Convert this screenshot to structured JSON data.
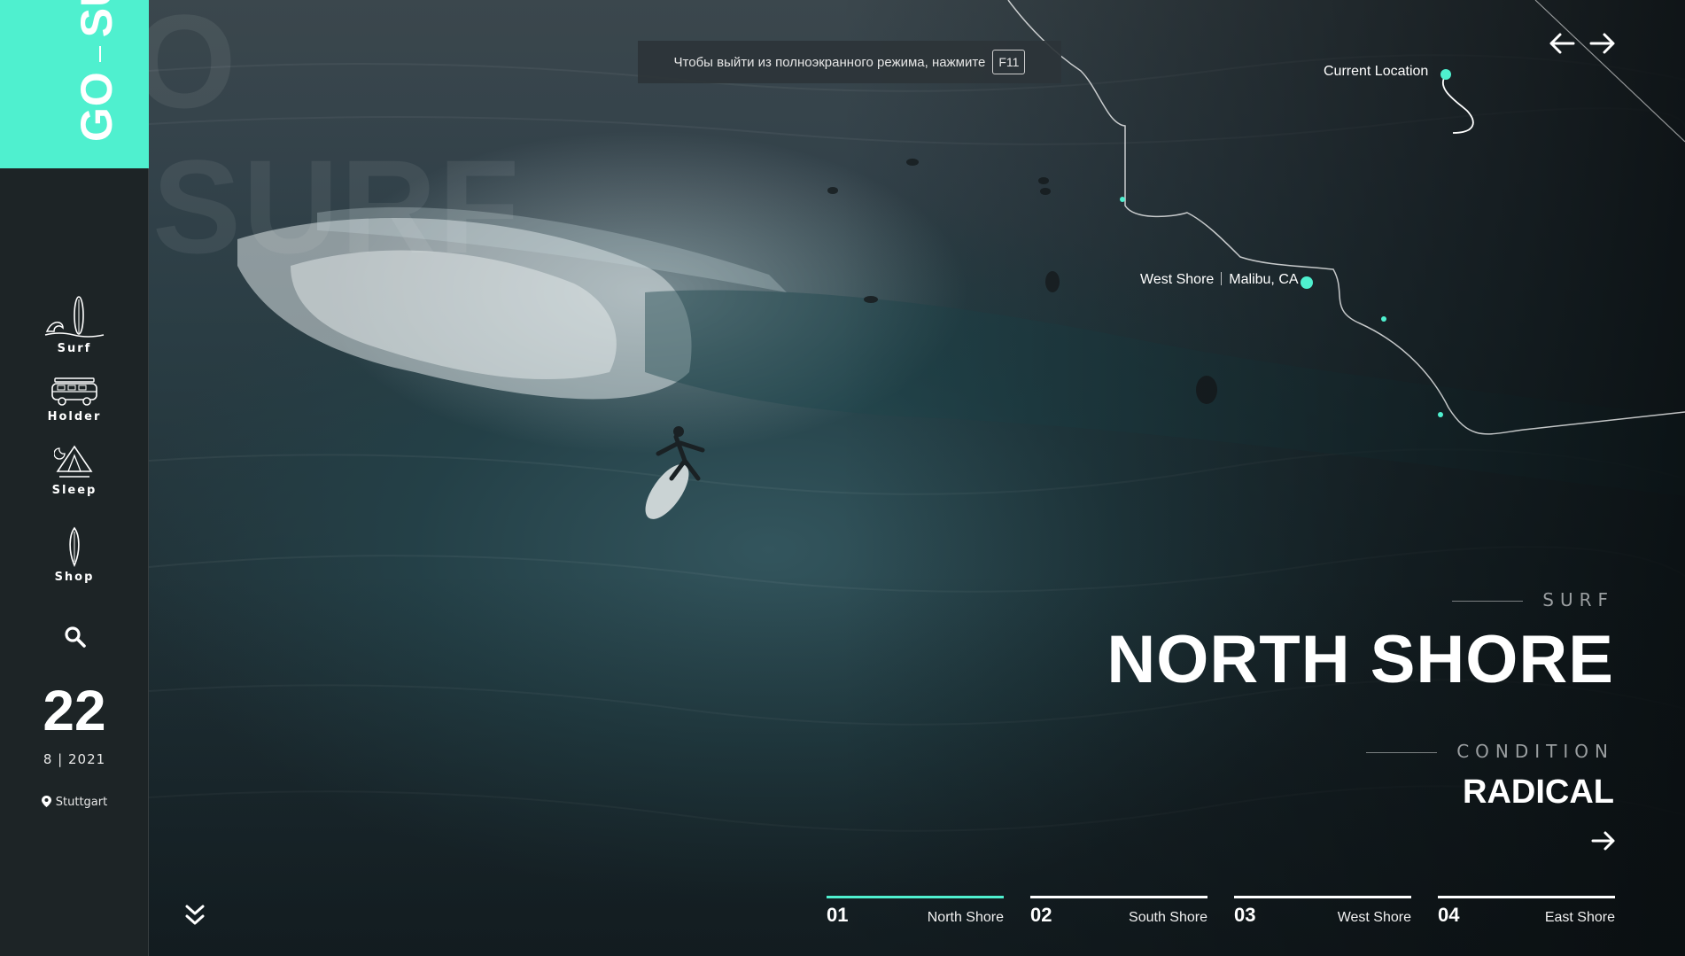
{
  "brand": {
    "part1": "GO",
    "part2": "SURF",
    "ghost_top": "O",
    "ghost_mid": "SURF"
  },
  "nav": [
    {
      "label": "Surf",
      "icon": "surfboard-wave-icon"
    },
    {
      "label": "Holder",
      "icon": "van-icon"
    },
    {
      "label": "Sleep",
      "icon": "tent-icon"
    },
    {
      "label": "Shop",
      "icon": "board-icon"
    }
  ],
  "search": {
    "icon": "search-icon"
  },
  "date": {
    "day": "22",
    "month_year": "8 | 2021"
  },
  "location": {
    "city": "Stuttgart",
    "icon": "map-pin-icon"
  },
  "fullscreen_toast": {
    "text": "Чтобы выйти из полноэкранного режима, нажмите",
    "key": "F11"
  },
  "map": {
    "current_location_label": "Current Location",
    "spot_name": "West Shore",
    "spot_place": "Malibu, CA"
  },
  "hero": {
    "eyebrow": "SURF",
    "title": "NORTH SHORE",
    "condition_label": "CONDITION",
    "condition_value": "RADICAL"
  },
  "tabs": [
    {
      "num": "01",
      "name": "North Shore",
      "active": true
    },
    {
      "num": "02",
      "name": "South Shore",
      "active": false
    },
    {
      "num": "03",
      "name": "West Shore",
      "active": false
    },
    {
      "num": "04",
      "name": "East Shore",
      "active": false
    }
  ],
  "colors": {
    "accent": "#4ff0cf",
    "sidebar": "#1d2426"
  }
}
